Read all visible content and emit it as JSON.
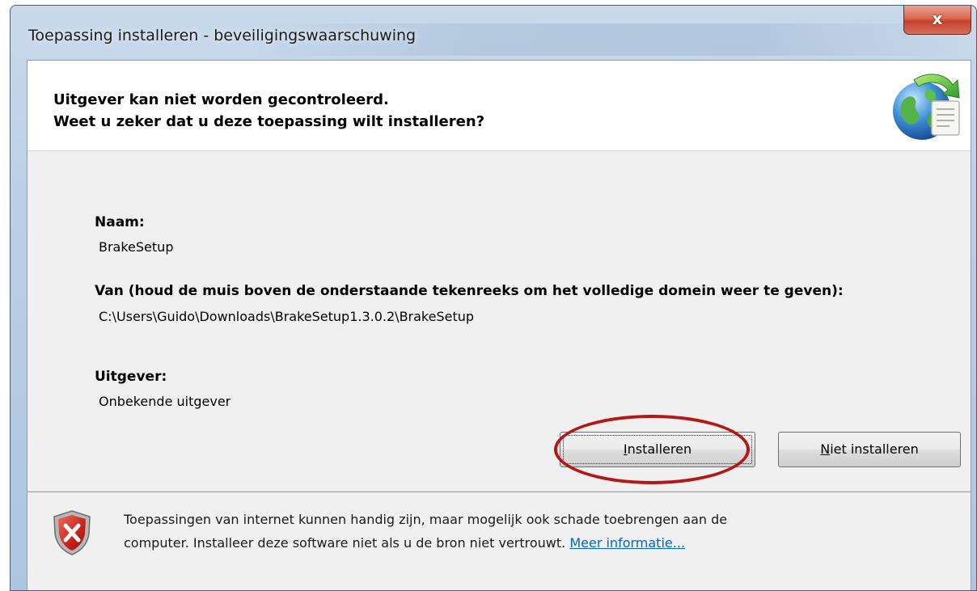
{
  "window": {
    "title": "Toepassing installeren - beveiligingswaarschuwing",
    "close_glyph": "x"
  },
  "header": {
    "line1": "Uitgever kan niet worden gecontroleerd.",
    "line2": "Weet u zeker dat u deze toepassing wilt installeren?",
    "icon": "globe-install-icon"
  },
  "fields": {
    "name_label": "Naam:",
    "name_value": "BrakeSetup",
    "from_label": "Van (houd de muis boven de onderstaande tekenreeks om het volledige domein weer te geven):",
    "from_value": "C:\\Users\\Guido\\Downloads\\BrakeSetup1.3.0.2\\BrakeSetup",
    "publisher_label": "Uitgever:",
    "publisher_value": "Onbekende uitgever"
  },
  "buttons": {
    "install_mnemonic": "I",
    "install_rest": "nstalleren",
    "noinstall_mnemonic": "N",
    "noinstall_rest": "iet installeren"
  },
  "footer": {
    "icon": "shield-warning-icon",
    "line1": "Toepassingen van internet kunnen handig zijn, maar mogelijk ook schade toebrengen aan de",
    "line2": "computer. Installeer deze software niet als u de bron niet vertrouwt.",
    "link": "Meer informatie..."
  },
  "colors": {
    "annotation_ellipse": "#b31717",
    "link": "#0066cc",
    "close_button": "#c5412b"
  }
}
